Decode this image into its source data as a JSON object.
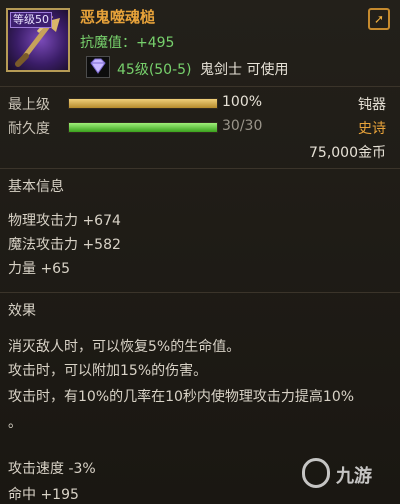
{
  "item": {
    "level_badge": "等级50",
    "name": "恶鬼噬魂槌",
    "magic_resist": "抗魔值：+495",
    "requirement_level": "45级(50-5)",
    "requirement_class": "鬼剑士 可使用"
  },
  "grade": {
    "label": "最上级",
    "value_text": "100%",
    "fill_ratio": 1.0,
    "type": "钝器"
  },
  "durability": {
    "label": "耐久度",
    "value_text": "30/30",
    "fill_ratio": 1.0,
    "rarity": "史诗"
  },
  "price": "75,000金币",
  "basic_info": {
    "title": "基本信息",
    "stats": [
      {
        "label": "物理攻击力",
        "value": "+674"
      },
      {
        "label": "魔法攻击力",
        "value": "+582"
      },
      {
        "label": "力量",
        "value": "+65"
      }
    ]
  },
  "effects": {
    "title": "效果",
    "lines": [
      "消灭敌人时，可以恢复5%的生命值。",
      "攻击时，可以附加15%的伤害。",
      "攻击时，有10%的几率在10秒内使物理攻击力提高10%",
      "。"
    ]
  },
  "extra_stats": [
    "攻击速度 -3%",
    "命中 +195"
  ],
  "colors": {
    "name": "#e8a33a",
    "green": "#77d06c",
    "epic": "#e8a33a",
    "grade_bar": "#d8b24c",
    "durability_bar": "#5bd12d"
  },
  "watermark": {
    "text": "九游"
  }
}
